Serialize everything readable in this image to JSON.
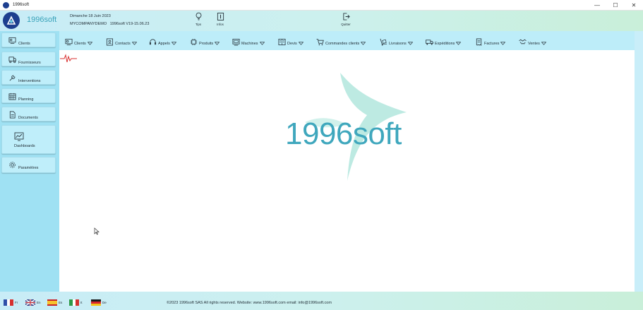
{
  "window": {
    "title": "1996soft",
    "controls": {
      "minimize": "—",
      "maximize": "☐",
      "close": "✕"
    }
  },
  "header": {
    "logo_text": "1996soft",
    "date": "Dimanche 18 Juin 2023",
    "company": "MYCOMPANYDEMO",
    "version": "1996soft V19-15.06.23",
    "buttons": [
      {
        "label": "Tips",
        "icon": "lightbulb-icon"
      },
      {
        "label": "Infos",
        "icon": "info-icon"
      },
      {
        "label": "Quitter",
        "icon": "exit-icon"
      }
    ]
  },
  "sidebar": {
    "items": [
      {
        "label": "Clients",
        "icon": "clients-icon"
      },
      {
        "label": "Fournisseurs",
        "icon": "suppliers-icon"
      },
      {
        "label": "Interventions",
        "icon": "wrench-icon"
      },
      {
        "label": "Planning",
        "icon": "calendar-icon"
      },
      {
        "label": "Documents",
        "icon": "document-icon"
      },
      {
        "label": "Dashboards",
        "icon": "chart-icon"
      },
      {
        "label": "Paramètres",
        "icon": "gear-icon"
      }
    ]
  },
  "menubar": {
    "items": [
      {
        "label": "Clients",
        "icon": "clients-icon"
      },
      {
        "label": "Contacts",
        "icon": "contacts-icon"
      },
      {
        "label": "Appels",
        "icon": "headset-icon"
      },
      {
        "label": "Produits",
        "icon": "chip-icon"
      },
      {
        "label": "Machines",
        "icon": "machine-icon"
      },
      {
        "label": "Devis",
        "icon": "quote-icon"
      },
      {
        "label": "Commandes clients",
        "icon": "cart-icon"
      },
      {
        "label": "Livraisons",
        "icon": "trolley-icon"
      },
      {
        "label": "Expéditions",
        "icon": "truck-icon"
      },
      {
        "label": "Factures",
        "icon": "invoice-icon"
      },
      {
        "label": "Ventes",
        "icon": "handshake-icon"
      }
    ]
  },
  "main": {
    "brand_text": "1996soft"
  },
  "footer": {
    "languages": [
      {
        "code": "Fr",
        "colors": [
          "#2f4fa8",
          "#ffffff",
          "#d6312f"
        ]
      },
      {
        "code": "En",
        "colors": [
          "#2c3e86",
          "#c9cde0",
          "#c0303a"
        ]
      },
      {
        "code": "Es",
        "colors": [
          "#c8222a",
          "#f6c22d",
          "#c8222a"
        ]
      },
      {
        "code": "It",
        "colors": [
          "#2d9a47",
          "#ffffff",
          "#d3342f"
        ]
      },
      {
        "code": "De",
        "colors": [
          "#1a1a1a",
          "#d8262d",
          "#f2c318"
        ]
      }
    ],
    "copyright": "©2023 1996soft SAS All rights reserved. Website: www.1996soft.com email: info@1996soft.com"
  },
  "colors": {
    "accent": "#3fa7bd",
    "sidebar_bg": "#9fe1f3",
    "menubar_bg": "#bdedf9",
    "watermark": "#9adfd2",
    "logo_bg": "#1d3f8f"
  }
}
